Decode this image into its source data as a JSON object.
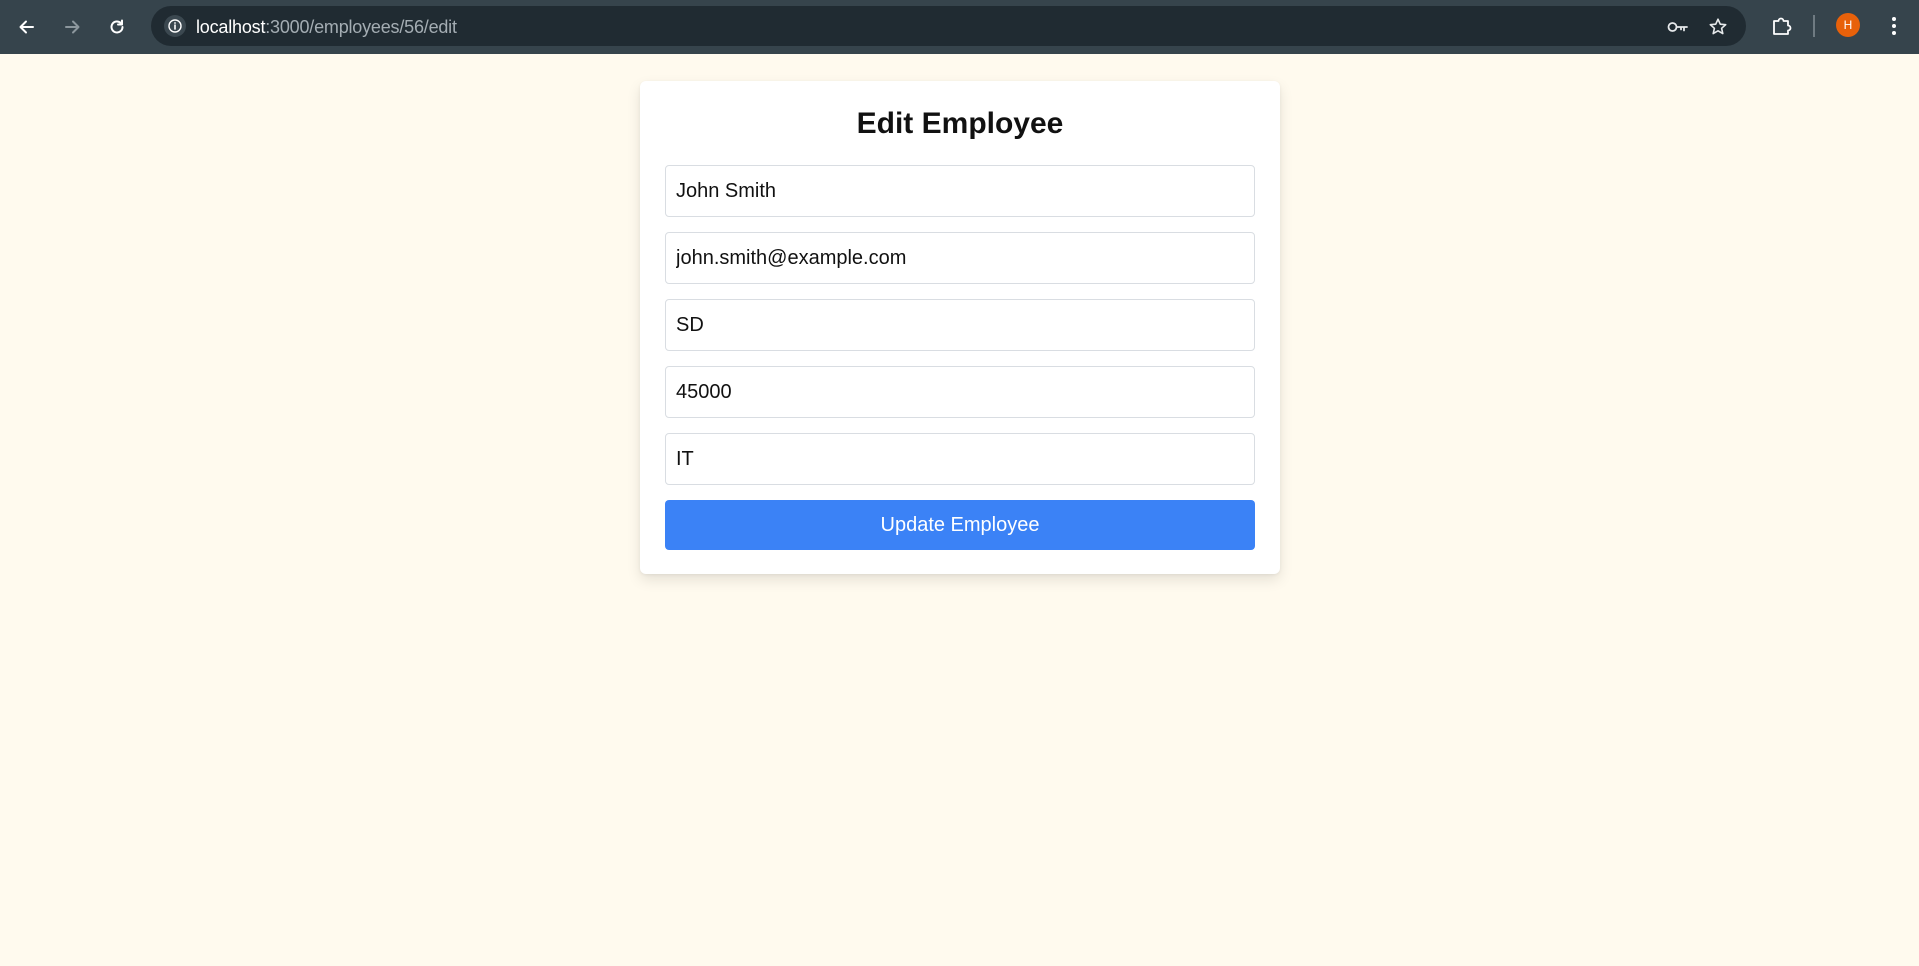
{
  "browser": {
    "url_host": "localhost",
    "url_path": ":3000/employees/56/edit",
    "profile_initial": "H",
    "icons": {
      "back": "arrow-left-icon",
      "forward": "arrow-right-icon",
      "reload": "reload-icon",
      "site_info": "info-icon",
      "password": "key-icon",
      "bookmark": "star-icon",
      "extensions": "puzzle-icon",
      "menu": "kebab-menu-icon"
    },
    "colors": {
      "toolbar": "#36444c",
      "omnibox": "#202b32",
      "avatar": "#e8610a"
    }
  },
  "form": {
    "title": "Edit Employee",
    "fields": {
      "name": "John Smith",
      "email": "john.smith@example.com",
      "position": "SD",
      "salary": "45000",
      "department": "IT"
    },
    "submit_label": "Update Employee"
  },
  "colors": {
    "page_background": "#fffaee",
    "button": "#3b82f6"
  }
}
